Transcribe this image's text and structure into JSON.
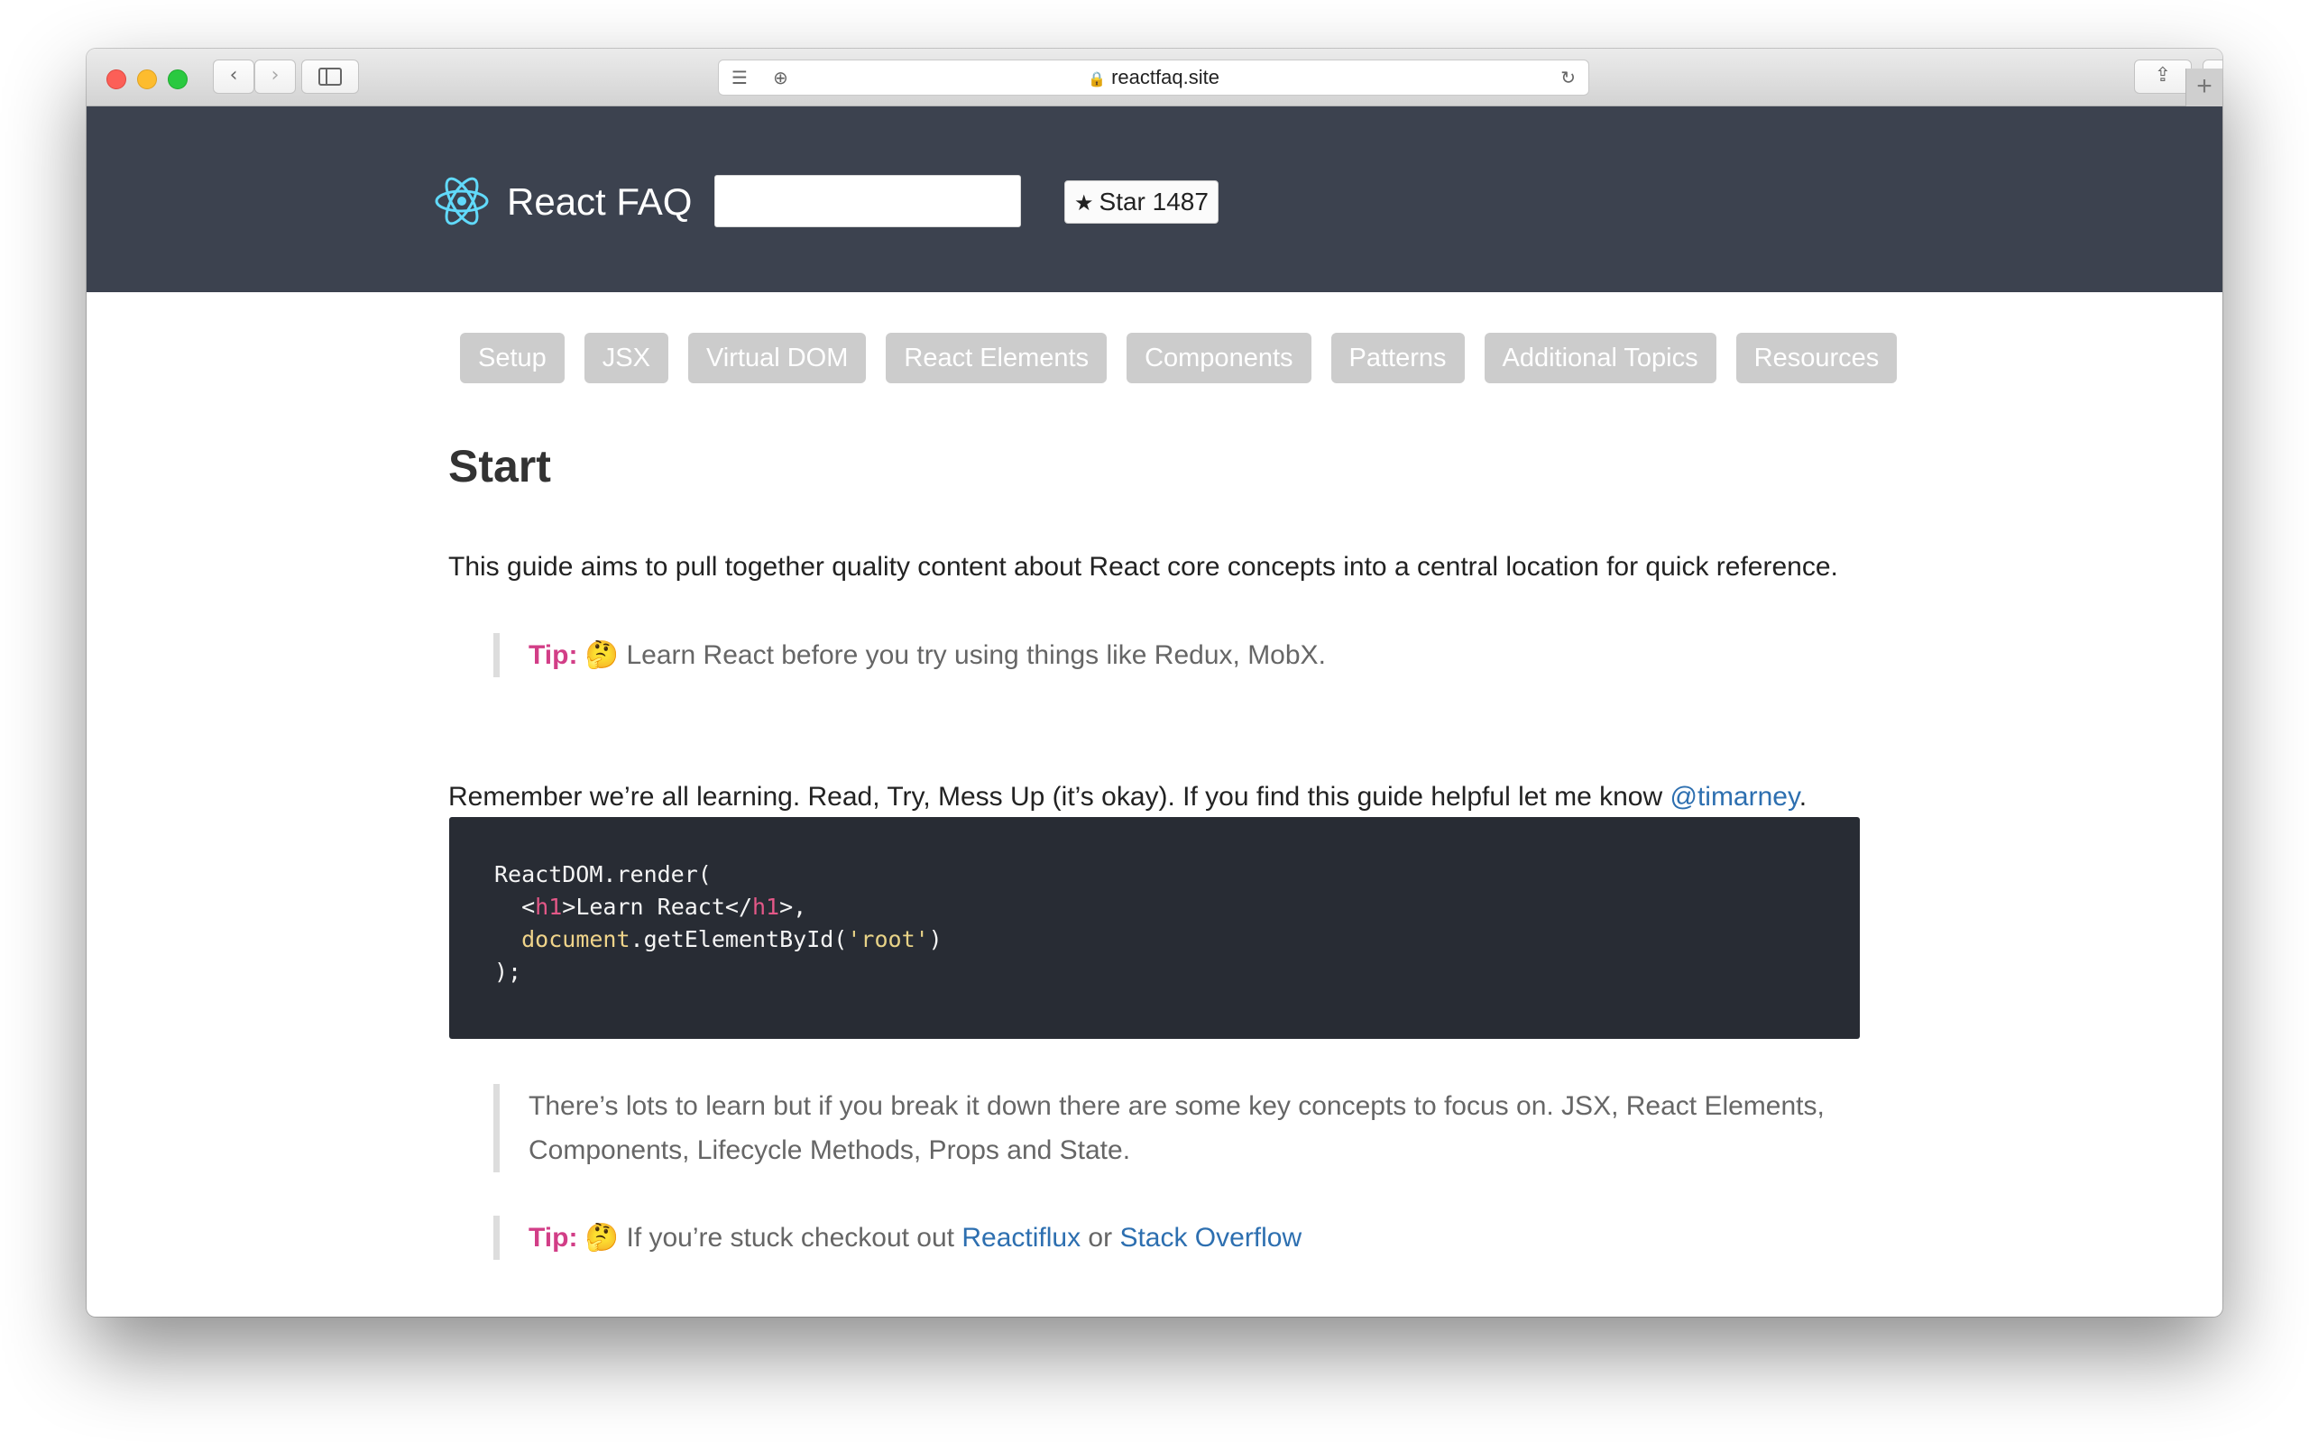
{
  "browser": {
    "url": "reactfaq.site"
  },
  "header": {
    "brand": "React FAQ",
    "search_value": "",
    "star_label": "Star 1487"
  },
  "nav": [
    "Setup",
    "JSX",
    "Virtual DOM",
    "React Elements",
    "Components",
    "Patterns",
    "Additional Topics",
    "Resources"
  ],
  "main": {
    "heading": "Start",
    "intro": "This guide aims to pull together quality content about React core concepts into a central location for quick reference.",
    "tip1": {
      "label": "Tip:",
      "emoji": "🤔",
      "text": "Learn React before you try using things like Redux, MobX."
    },
    "remember": {
      "text": "Remember we’re all learning. Read, Try, Mess Up (it’s okay). If you find this guide helpful let me know",
      "link": "@timarney",
      "tail": "."
    },
    "code": {
      "line1": "ReactDOM.render(",
      "line2_open": "<",
      "line2_tag": "h1",
      "line2_mid": ">Learn React</",
      "line2_tag2": "h1",
      "line2_close": ">,",
      "line3_kw": "document",
      "line3_mid": ".getElementById(",
      "line3_str": "'root'",
      "line3_end": ")",
      "line4": ");"
    },
    "quote": {
      "line1": "There’s lots to learn but if you break it down there are some key concepts to focus on. JSX, React Elements,",
      "line2": "Components, Lifecycle Methods, Props and State."
    },
    "tip2": {
      "label": "Tip:",
      "emoji": "🤔",
      "text": "If you’re stuck checkout out",
      "link1": "Reactiflux",
      "or": "or",
      "link2": "Stack Overflow"
    }
  },
  "colors": {
    "header_bg": "#3c424f",
    "pill_bg": "#cccccc",
    "tip_label": "#d23e87",
    "link": "#2d6fb0",
    "code_bg": "#282c34"
  }
}
